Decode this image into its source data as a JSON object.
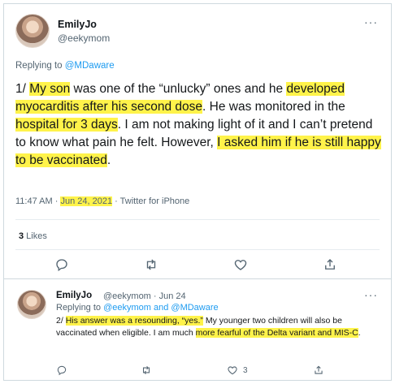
{
  "main_tweet": {
    "author_name": "EmilyJo",
    "author_handle": "@eekymom",
    "more_menu": "···",
    "replying_prefix": "Replying to ",
    "replying_to": "@MDaware",
    "body": {
      "seg1": "1/ ",
      "seg2": "My son",
      "seg3": " was one of the “unlucky” ones and he ",
      "seg4": "developed myocarditis after his second dose",
      "seg5": ". He was monitored in the ",
      "seg6": "hospital for 3 days",
      "seg7": ". I am not making light of it and I can’t pretend to know what pain he felt. However, ",
      "seg8": "I asked him if he is still happy to be vaccinated",
      "seg9": "."
    },
    "time": "11:47 AM",
    "sep1": " · ",
    "date": "Jun 24, 2021",
    "sep2": " · ",
    "source": "Twitter for iPhone",
    "likes_count": "3",
    "likes_label": " Likes",
    "icons": [
      "reply-icon",
      "retweet-icon",
      "like-icon",
      "share-icon"
    ]
  },
  "reply_tweet": {
    "author_name": "EmilyJo",
    "author_handle": "@eekymom · Jun 24",
    "more_menu": "···",
    "replying_prefix": "Replying to ",
    "replying_to": "@eekymom and @MDaware",
    "body": {
      "seg1": "2/ ",
      "seg2": "His answer was a resounding, “yes.”",
      "seg3": " My younger two children will also be vaccinated when eligible. I am much ",
      "seg4": "more fearful of the Delta variant and MIS-C",
      "seg5": "."
    },
    "like_count": "3",
    "icons": [
      "reply-icon",
      "retweet-icon",
      "like-icon",
      "share-icon"
    ]
  },
  "colors": {
    "highlight": "#fff34a",
    "link": "#1d9bf0",
    "muted": "#536471",
    "text": "#14171a"
  }
}
